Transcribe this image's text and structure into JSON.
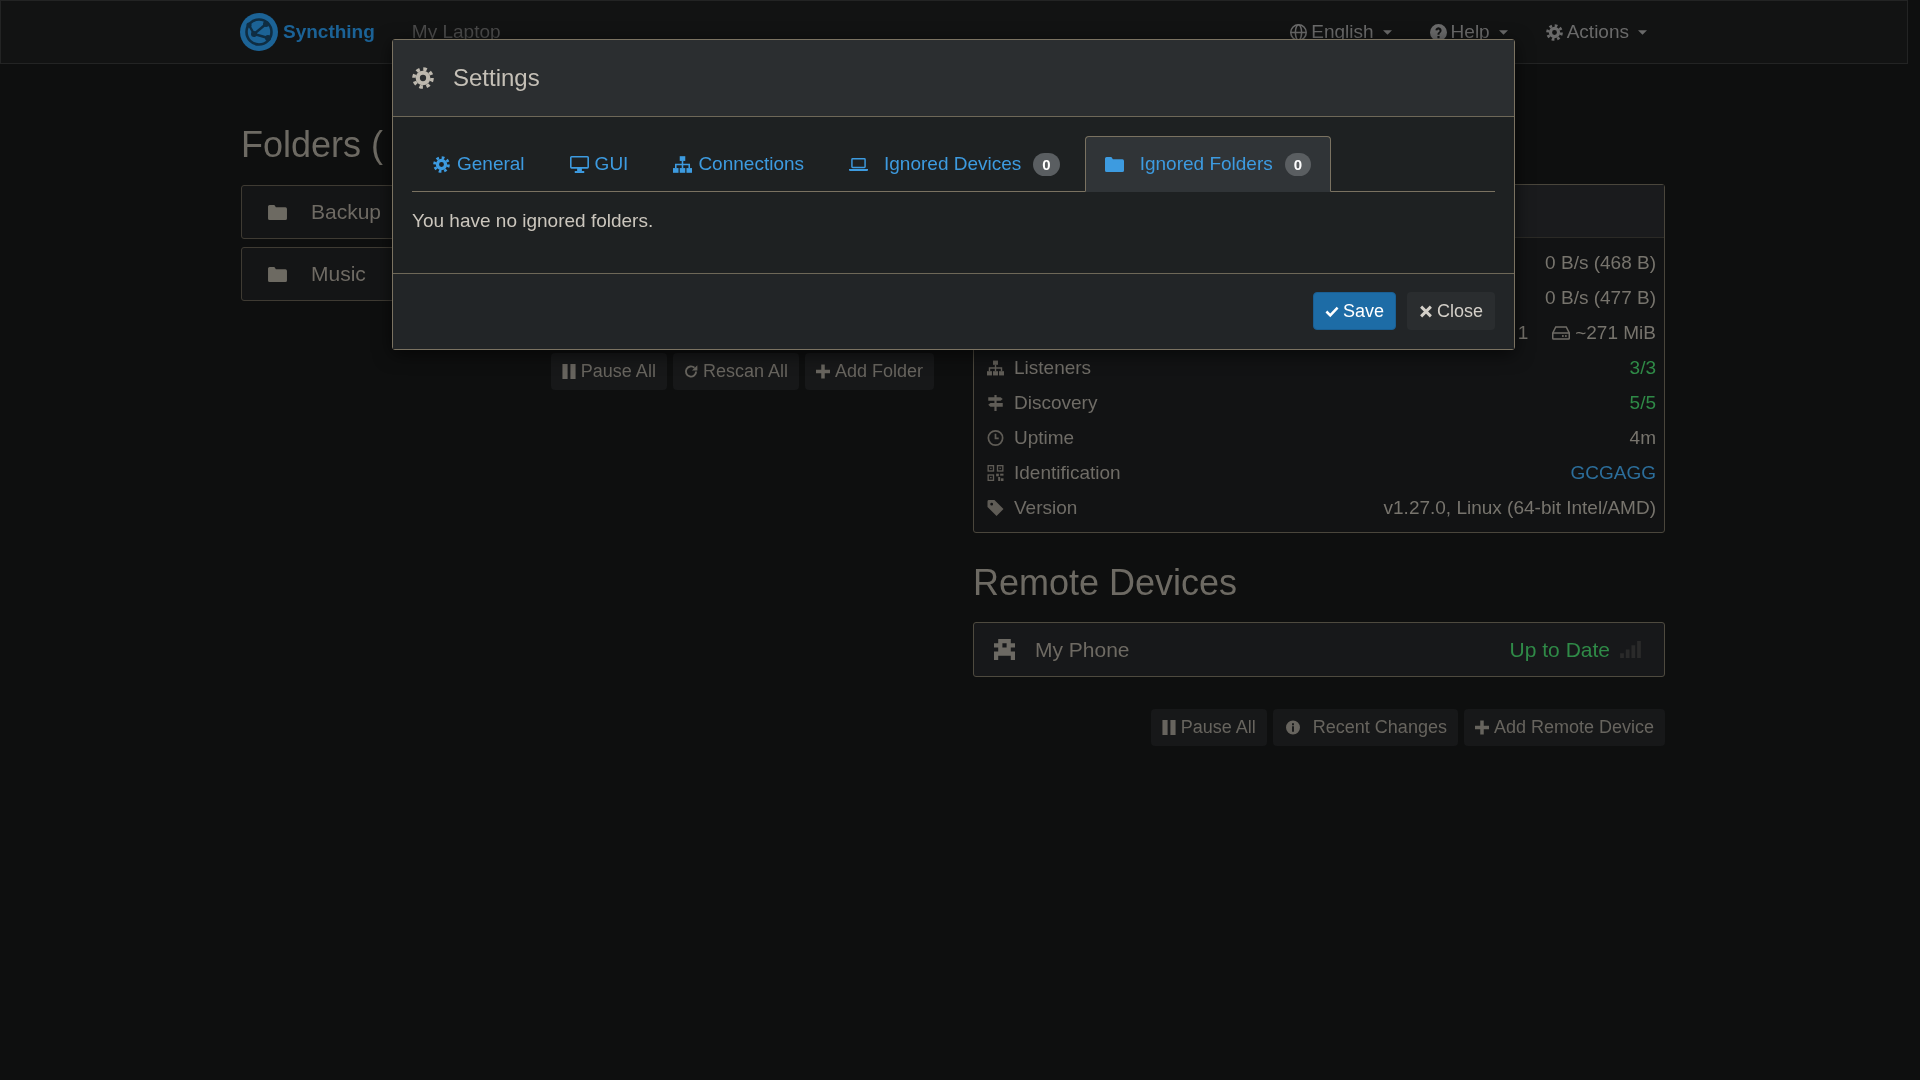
{
  "navbar": {
    "brand": "Syncthing",
    "device_name": "My Laptop",
    "menus": [
      {
        "kind": "language",
        "label": "English"
      },
      {
        "kind": "help",
        "label": "Help"
      },
      {
        "kind": "actions",
        "label": "Actions"
      }
    ]
  },
  "folders": {
    "heading": "Folders (",
    "items": [
      {
        "name": "Backup"
      },
      {
        "name": "Music"
      }
    ],
    "buttons": [
      {
        "kind": "pause",
        "label": "Pause All"
      },
      {
        "kind": "rescan",
        "label": "Rescan All"
      },
      {
        "kind": "add",
        "label": "Add Folder"
      }
    ]
  },
  "this_device": {
    "rows": [
      {
        "kind": "download",
        "value": "0 B/s (468 B)"
      },
      {
        "kind": "upload",
        "value": "0 B/s (477 B)"
      },
      {
        "kind": "local",
        "files": "1",
        "size": "~271 MiB"
      },
      {
        "kind": "listeners",
        "label": "Listeners",
        "value": "3/3"
      },
      {
        "kind": "discovery",
        "label": "Discovery",
        "value": "5/5"
      },
      {
        "kind": "uptime",
        "label": "Uptime",
        "value": "4m"
      },
      {
        "kind": "identification",
        "label": "Identification",
        "value": "GCGAGG"
      },
      {
        "kind": "version",
        "label": "Version",
        "value": "v1.27.0, Linux (64-bit Intel/AMD)"
      }
    ]
  },
  "remote_devices": {
    "heading": "Remote Devices",
    "devices": [
      {
        "name": "My Phone",
        "status": "Up to Date"
      }
    ],
    "buttons": [
      {
        "kind": "pause",
        "label": "Pause All"
      },
      {
        "kind": "changes",
        "label": "Recent Changes"
      },
      {
        "kind": "add",
        "label": "Add Remote Device"
      }
    ]
  },
  "dialog": {
    "title": "Settings",
    "tabs": [
      {
        "kind": "general",
        "label": "General",
        "selected": false
      },
      {
        "kind": "gui",
        "label": "GUI",
        "selected": false
      },
      {
        "kind": "connections",
        "label": "Connections",
        "selected": false
      },
      {
        "kind": "devices",
        "label": "Ignored Devices",
        "badge": "0",
        "selected": false
      },
      {
        "kind": "folders",
        "label": "Ignored Folders",
        "badge": "0",
        "selected": true
      }
    ],
    "message": "You have no ignored folders.",
    "buttons": [
      {
        "kind": "save",
        "label": "Save"
      },
      {
        "kind": "close",
        "label": "Close"
      }
    ]
  }
}
